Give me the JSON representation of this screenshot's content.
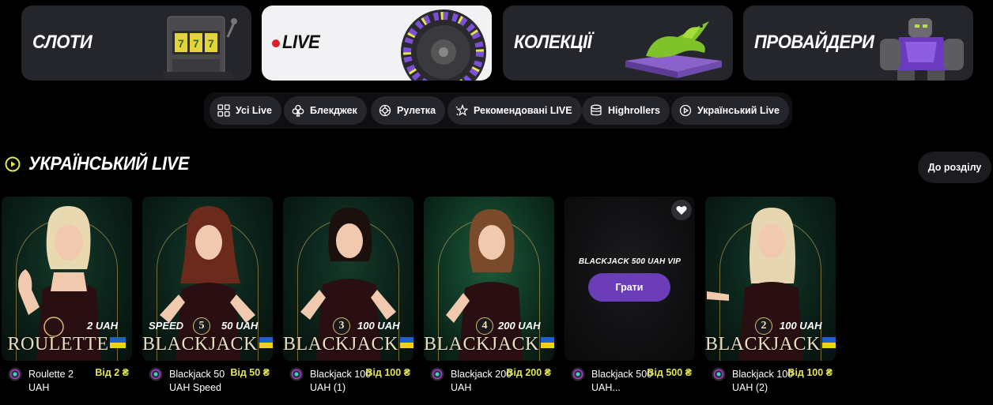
{
  "categories": [
    {
      "label": "СЛОТИ",
      "icon": "slot-machine-icon",
      "active": false
    },
    {
      "label": "LIVE",
      "icon": "roulette-wheel-icon",
      "active": true
    },
    {
      "label": "КОЛЕКЦІЇ",
      "icon": "dragon-book-icon",
      "active": false
    },
    {
      "label": "ПРОВАЙДЕРИ",
      "icon": "golem-icon",
      "active": false
    }
  ],
  "filters": [
    {
      "label": "Усі Live",
      "icon": "grid-icon"
    },
    {
      "label": "Блекджек",
      "icon": "clubs-icon"
    },
    {
      "label": "Рулетка",
      "icon": "roulette-icon"
    },
    {
      "label": "Рекомендовані LIVE",
      "icon": "stars-icon"
    },
    {
      "label": "Highrollers",
      "icon": "coins-icon"
    },
    {
      "label": "Український Live",
      "icon": "play-circle-icon"
    }
  ],
  "section": {
    "title": "УКРАЇНСЬКИЙ LIVE",
    "to_section_label": "До розділу",
    "accent": "#e3e64f"
  },
  "games": [
    {
      "thumb_name": "ROULETTE",
      "number": "",
      "pre": "",
      "stake": "2 UAH",
      "title": "Roulette 2 UAH",
      "min": "Від 2 ₴"
    },
    {
      "thumb_name": "BLACKJACK",
      "number": "5",
      "pre": "SPEED",
      "stake": "50 UAH",
      "title": "Blackjack 50 UAH Speed",
      "min": "Від 50 ₴"
    },
    {
      "thumb_name": "BLACKJACK",
      "number": "3",
      "pre": "",
      "stake": "100 UAH",
      "title": "Blackjack 100 UAH (1)",
      "min": "Від 100 ₴"
    },
    {
      "thumb_name": "BLACKJACK",
      "number": "4",
      "pre": "",
      "stake": "200 UAH",
      "title": "Blackjack 200 UAH",
      "min": "Від 200 ₴"
    },
    {
      "vip_title": "BLACKJACK 500 UAH VIP",
      "play_label": "Грати",
      "title": "Blackjack 500 UAH...",
      "min": "Від 500 ₴"
    },
    {
      "thumb_name": "BLACKJACK",
      "number": "2",
      "pre": "",
      "stake": "100 UAH",
      "title": "Blackjack 100 UAH (2)",
      "min": "Від 100 ₴"
    }
  ],
  "colors": {
    "play_button": "#6b3db8",
    "live_dot": "#e01e2a",
    "card_bg": "#25252c"
  }
}
